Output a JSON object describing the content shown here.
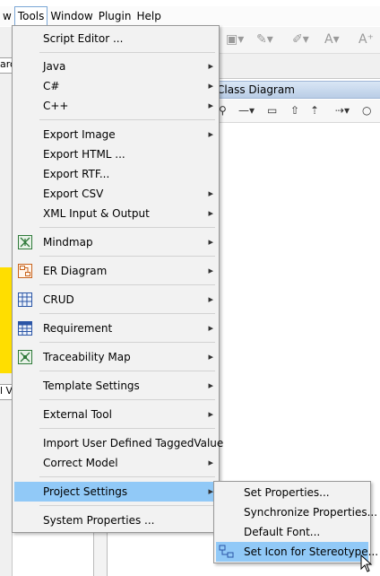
{
  "menubar": {
    "items": [
      {
        "label": "w"
      },
      {
        "label": "Tools"
      },
      {
        "label": "Window"
      },
      {
        "label": "Plugin"
      },
      {
        "label": "Help"
      }
    ]
  },
  "background": {
    "left_strip_1": "aro",
    "left_strip_2": "l Vi",
    "diagram_title": "Class Diagram"
  },
  "tools_menu": {
    "script_editor": "Script Editor ...",
    "java": "Java",
    "csharp": "C#",
    "cpp": "C++",
    "export_image": "Export Image",
    "export_html": "Export HTML ...",
    "export_rtf": "Export RTF...",
    "export_csv": "Export CSV",
    "xml_io": "XML Input & Output",
    "mindmap": "Mindmap",
    "er_diagram": "ER Diagram",
    "crud": "CRUD",
    "requirement": "Requirement",
    "traceability": "Traceability Map",
    "template_settings": "Template Settings",
    "external_tool": "External Tool",
    "import_tagged": "Import User Defined TaggedValue",
    "correct_model": "Correct Model",
    "project_settings": "Project Settings",
    "system_properties": "System Properties ..."
  },
  "submenu": {
    "set_properties": "Set Properties...",
    "sync_properties": "Synchronize Properties...",
    "default_font": "Default Font...",
    "set_icon": "Set Icon for Stereotype..."
  },
  "icons": {
    "submenu_arrow": "▸",
    "mindmap": "mindmap-icon",
    "er": "er-diagram-icon",
    "crud": "crud-icon",
    "requirement": "requirement-icon",
    "traceability": "traceability-map-icon",
    "stereotype": "stereotype-icon"
  },
  "colors": {
    "highlight": "#91c9f7",
    "menu_bg": "#f2f2f2",
    "yellow": "#ffde00"
  }
}
